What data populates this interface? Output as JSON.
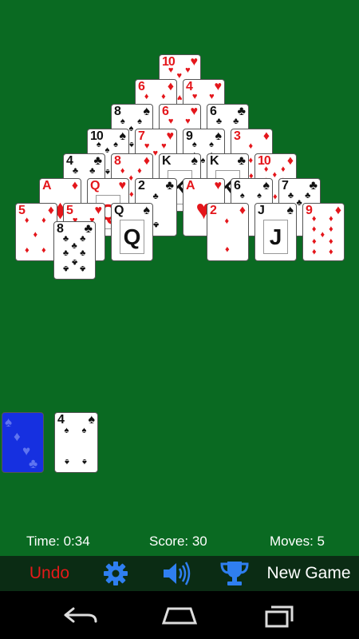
{
  "status": {
    "time": "Time: 0:34",
    "score": "Score: 30",
    "moves": "Moves: 5"
  },
  "toolbar": {
    "undo_label": "Undo",
    "settings_icon": "gear-icon",
    "sound_icon": "speaker-icon",
    "trophy_icon": "trophy-icon",
    "new_game_label": "New Game"
  },
  "navbar": {
    "back_icon": "back-icon",
    "home_icon": "home-icon",
    "recents_icon": "recents-icon"
  },
  "colors": {
    "felt": "#0a6a22",
    "toolbar": "#0b2c14",
    "red_suit": "#e4161b",
    "card_back": "#1630e0"
  },
  "waste": {
    "rank": "4",
    "suit": "♠"
  },
  "pyramid": [
    [
      {
        "rank": "10",
        "suit": "♥"
      }
    ],
    [
      {
        "rank": "6",
        "suit": "♦"
      },
      {
        "rank": "4",
        "suit": "♥"
      }
    ],
    [
      {
        "rank": "8",
        "suit": "♠"
      },
      {
        "rank": "6",
        "suit": "♥"
      },
      {
        "rank": "6",
        "suit": "♣"
      }
    ],
    [
      {
        "rank": "10",
        "suit": "♠"
      },
      {
        "rank": "7",
        "suit": "♥"
      },
      {
        "rank": "9",
        "suit": "♠"
      },
      {
        "rank": "3",
        "suit": "♦"
      }
    ],
    [
      {
        "rank": "4",
        "suit": "♣"
      },
      {
        "rank": "8",
        "suit": "♦"
      },
      {
        "rank": "K",
        "suit": "♠"
      },
      {
        "rank": "K",
        "suit": "♣"
      },
      {
        "rank": "10",
        "suit": "♦"
      }
    ],
    [
      {
        "rank": "A",
        "suit": "♦"
      },
      {
        "rank": "Q",
        "suit": "♥"
      },
      {
        "rank": "2",
        "suit": "♣"
      },
      {
        "rank": "A",
        "suit": "♥"
      },
      {
        "rank": "6",
        "suit": "♠"
      },
      {
        "rank": "7",
        "suit": "♣"
      }
    ],
    [
      {
        "rank": "5",
        "suit": "♦"
      },
      {
        "rank": "5",
        "suit": "♥"
      },
      {
        "rank": "Q",
        "suit": "♠"
      },
      {
        "rank": "",
        "suit": ""
      },
      {
        "rank": "2",
        "suit": "♦"
      },
      {
        "rank": "J",
        "suit": "♠"
      },
      {
        "rank": "9",
        "suit": "♦"
      }
    ]
  ],
  "dragged_card": {
    "rank": "8",
    "suit": "♣"
  }
}
